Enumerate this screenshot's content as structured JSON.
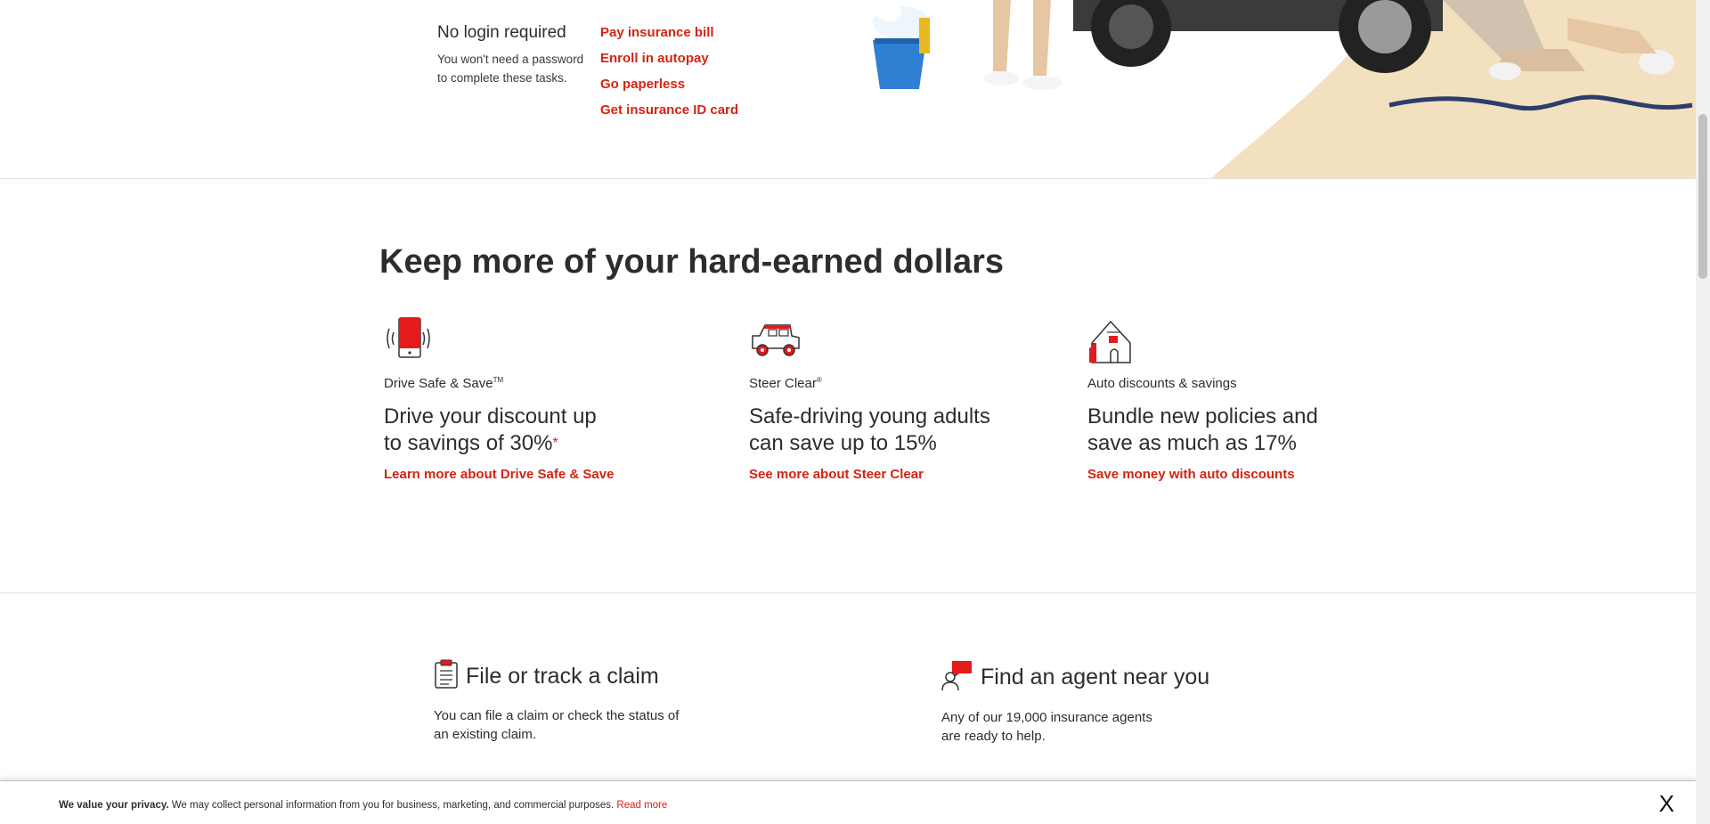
{
  "top": {
    "no_login": {
      "title": "No login required",
      "text_line1": "You won't need a password",
      "text_line2": "to complete these tasks."
    },
    "links": [
      "Pay insurance bill",
      "Enroll in autopay",
      "Go paperless",
      "Get insurance ID card"
    ]
  },
  "savings": {
    "title": "Keep more of your hard-earned dollars",
    "cards": [
      {
        "icon": "phone-vibrate-icon",
        "label": "Drive Safe & Save",
        "label_mark": "TM",
        "headline_line1": "Drive your discount up",
        "headline_line2": "to savings of 30%",
        "headline_mark": "*",
        "link": "Learn more about Drive Safe & Save"
      },
      {
        "icon": "car-icon",
        "label": "Steer Clear",
        "label_mark": "®",
        "headline_line1": "Safe-driving young adults",
        "headline_line2": "can save up to 15%",
        "link": "See more about Steer Clear"
      },
      {
        "icon": "house-icon",
        "label": "Auto discounts & savings",
        "headline_line1": "Bundle new policies and",
        "headline_line2": "save as much as 17%",
        "link": "Save money with auto discounts"
      }
    ]
  },
  "features": {
    "claim": {
      "icon": "clipboard-icon",
      "title": "File or track a claim",
      "text_line1": "You can file a claim or check the status of",
      "text_line2": "an existing claim."
    },
    "agent": {
      "icon": "agent-icon",
      "title": "Find an agent near you",
      "text_line1": "Any of our 19,000 insurance agents",
      "text_line2": "are ready to help."
    }
  },
  "privacy": {
    "bold": "We value your privacy.",
    "text": " We may collect personal information from you for business, marketing, and commercial purposes. ",
    "link": "Read more",
    "close": "X"
  },
  "colors": {
    "accent_red": "#d62311",
    "hero_beige": "#f3e0bf",
    "text": "#2d2d2d"
  }
}
